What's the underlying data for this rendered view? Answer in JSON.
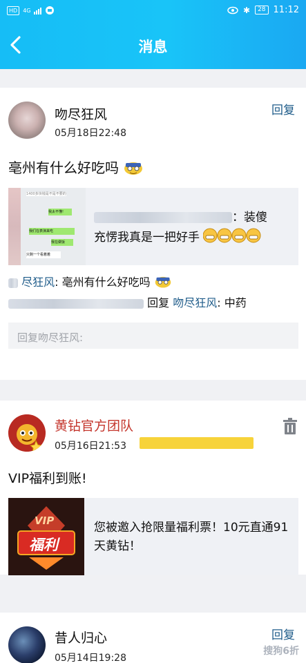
{
  "status": {
    "left_badge": "HD",
    "network": "4G",
    "battery": "28",
    "time": "11:12"
  },
  "header": {
    "title": "消息",
    "back_icon": "chevron-left-icon"
  },
  "messages": [
    {
      "author": "吻尽狂风",
      "time": "05月18日22:48",
      "action": "回复",
      "text": "亳州有什么好吃吗",
      "quote": {
        "text_visible": "：装傻",
        "line2": "充愣我真是一把好手",
        "thumb_bubbles": [
          "1400多块钱是不是不要的",
          "我太不懂!",
          "我们在表演来吃",
          "我在做饭",
          "只剩一个看着着"
        ]
      },
      "comments": [
        {
          "author": "尽狂风",
          "text": ": 亳州有什么好吃吗"
        },
        {
          "reply_word": "回复",
          "target": "吻尽狂风",
          "text": ": 中药"
        }
      ],
      "reply_placeholder": "回复吻尽狂风:"
    },
    {
      "author": "黄钻官方团队",
      "time": "05月16日21:53",
      "text": "VIP福利到账!",
      "promo": {
        "thumb_label_top": "VIP",
        "thumb_label_main": "福利",
        "text": "您被邀入抢限量福利票！10元直通91天黄钻！"
      },
      "delete_icon": "trash-icon"
    },
    {
      "author": "昔人归心",
      "time": "05月14日19:28",
      "action": "回复"
    }
  ],
  "watermark": "搜狗6折",
  "colors": {
    "header": "#16bdf6",
    "link": "#1f5c8a",
    "official_name": "#c4352c"
  }
}
